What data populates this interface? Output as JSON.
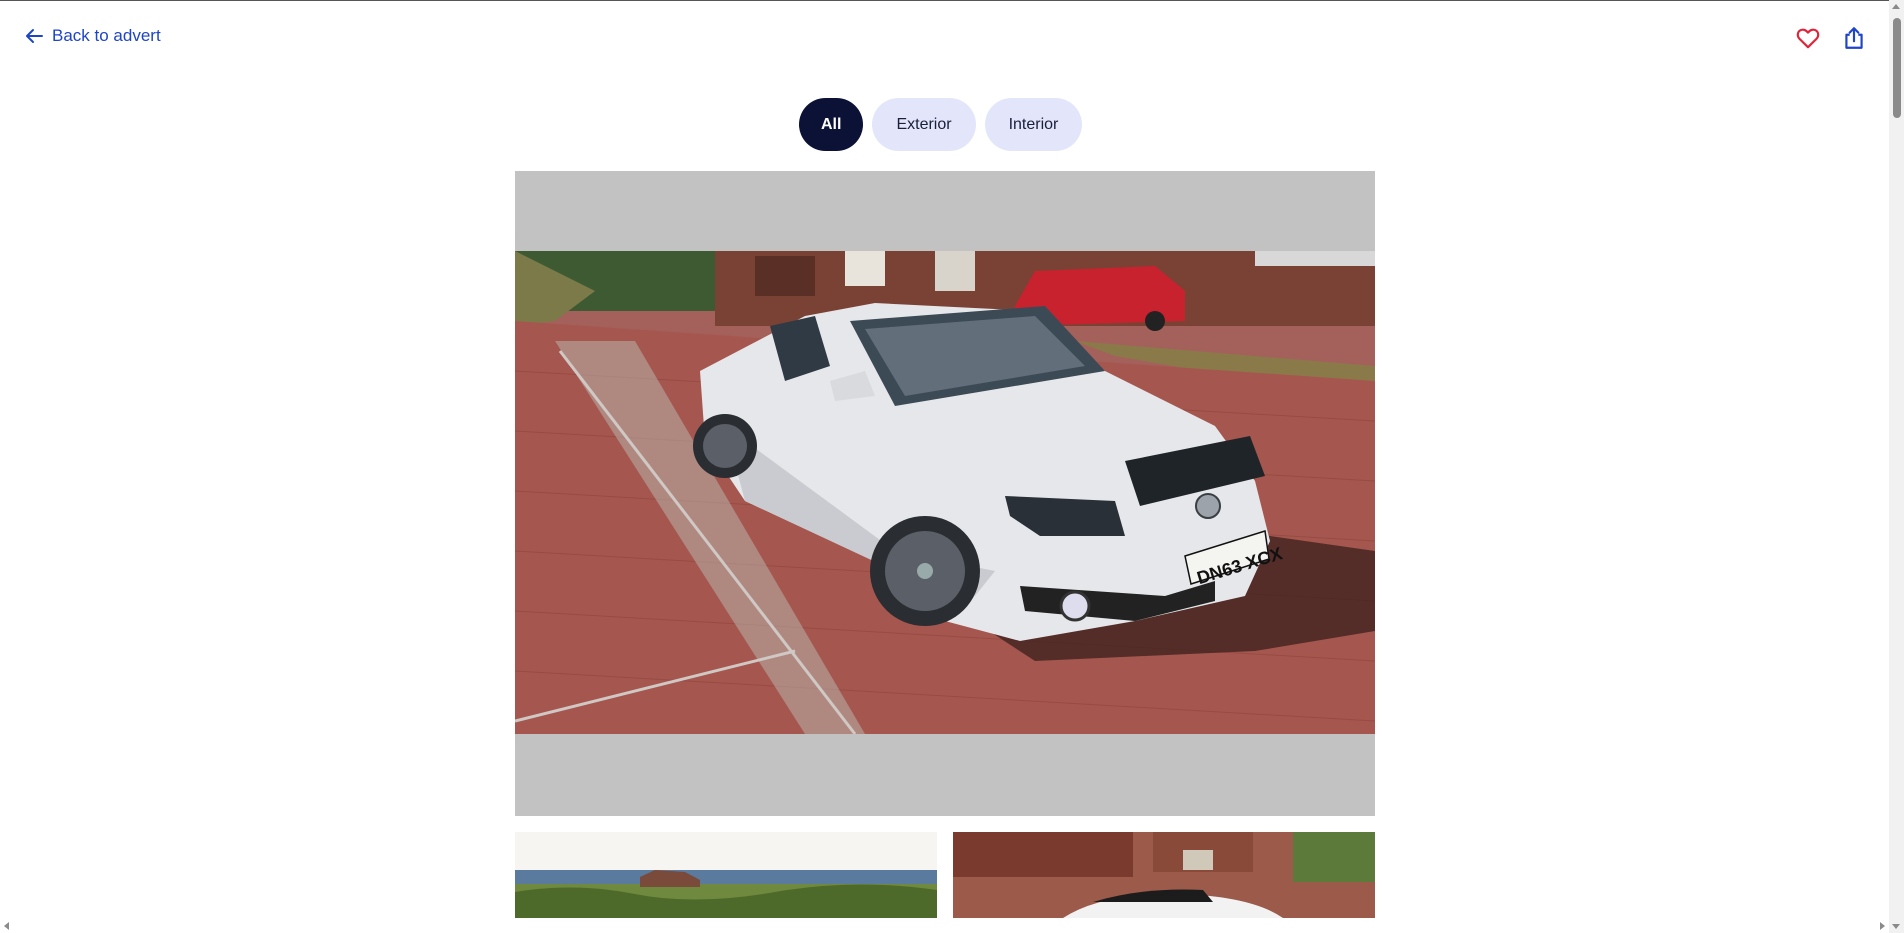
{
  "header": {
    "back_label": "Back to advert",
    "back_icon": "arrow-left-icon",
    "favourite_icon": "heart-icon",
    "share_icon": "share-icon"
  },
  "filters": {
    "tabs": [
      {
        "label": "All",
        "active": true
      },
      {
        "label": "Exterior",
        "active": false
      },
      {
        "label": "Interior",
        "active": false
      }
    ]
  },
  "gallery": {
    "main_photo": {
      "description_plate": "DN63 XCX"
    },
    "thumbnail_count_visible": 2
  },
  "colors": {
    "accent": "#1e44c8",
    "active_pill": "#0c1236",
    "inactive_pill": "#e3e6fb",
    "favourite": "#e0243a",
    "photo_letterbox": "#c2c2c2"
  }
}
